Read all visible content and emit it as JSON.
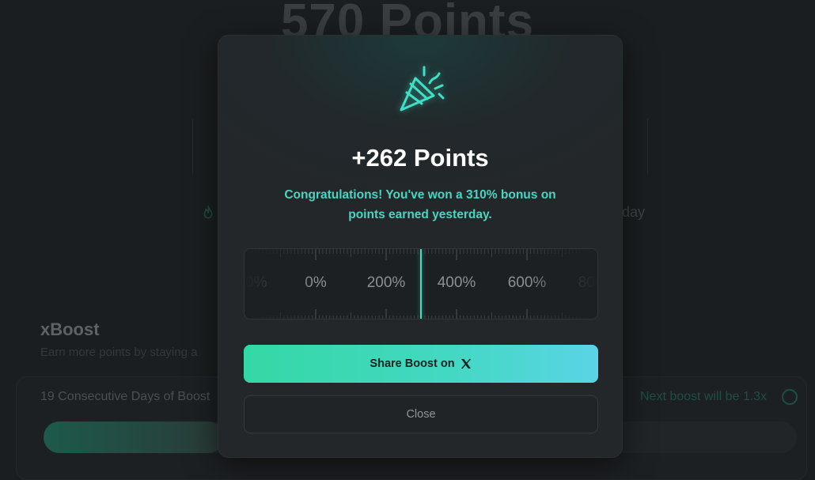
{
  "background": {
    "points_title": "570 Points",
    "streak_tail": "day",
    "xboost": {
      "title": "xBoost",
      "subtitle": "Earn more points by staying a",
      "consecutive_days": "19 Consecutive Days of Boost",
      "next_boost": "Next boost will be 1.3x",
      "progress": 0.24
    }
  },
  "modal": {
    "title": "+262 Points",
    "message": "Congratulations! You've won a 310% bonus on points earned yesterday.",
    "ruler": {
      "labels": [
        "-200%",
        "0%",
        "200%",
        "400%",
        "600%",
        "800%"
      ],
      "selected_value": "310%"
    },
    "share_button": {
      "label": "Share Boost on",
      "icon": "x-logo-icon"
    },
    "close_button": {
      "label": "Close"
    }
  },
  "colors": {
    "accent": "#47d6c1",
    "needle": "#3fe0c5",
    "button_gradient_start": "#34d8a5",
    "button_gradient_end": "#5ad4e6",
    "background": "#1b1e20",
    "modal": "#23272a"
  }
}
